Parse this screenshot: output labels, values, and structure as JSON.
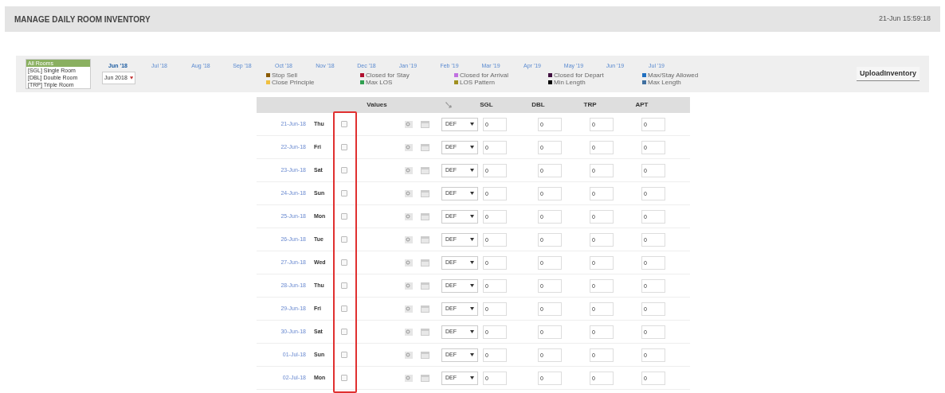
{
  "header": {
    "title": "MANAGE DAILY ROOM INVENTORY",
    "timestamp": "21-Jun 15:59:18"
  },
  "room_list": [
    {
      "label": "All Rooms",
      "selected": true
    },
    {
      "label": "[SGL] Single Room",
      "selected": false
    },
    {
      "label": "[DBL] Double Room",
      "selected": false
    },
    {
      "label": "[TRP] Triple Room",
      "selected": false
    }
  ],
  "month_select": {
    "value": "Jun 2018"
  },
  "months": [
    {
      "label": "Jun '18",
      "selected": true
    },
    {
      "label": "Jul '18",
      "selected": false
    },
    {
      "label": "Aug '18",
      "selected": false
    },
    {
      "label": "Sep '18",
      "selected": false
    },
    {
      "label": "Oct '18",
      "selected": false
    },
    {
      "label": "Nov '18",
      "selected": false
    },
    {
      "label": "Dec '18",
      "selected": false
    },
    {
      "label": "Jan '19",
      "selected": false
    },
    {
      "label": "Feb '19",
      "selected": false
    },
    {
      "label": "Mar '19",
      "selected": false
    },
    {
      "label": "Apr '19",
      "selected": false
    },
    {
      "label": "May '19",
      "selected": false
    },
    {
      "label": "Jun '19",
      "selected": false
    },
    {
      "label": "Jul '19",
      "selected": false
    }
  ],
  "legend": [
    [
      {
        "label": "Stop Sell",
        "color": "#8a5a00"
      },
      {
        "label": "Close Principle",
        "color": "#f0c040"
      }
    ],
    [
      {
        "label": "Closed for Stay",
        "color": "#b01030"
      },
      {
        "label": "Max LOS",
        "color": "#30a050"
      }
    ],
    [
      {
        "label": "Closed for Arrival",
        "color": "#c070e0"
      },
      {
        "label": "LOS Pattern",
        "color": "#a09020"
      }
    ],
    [
      {
        "label": "Closed for Depart",
        "color": "#401040"
      },
      {
        "label": "Min Length",
        "color": "#000000"
      }
    ],
    [
      {
        "label": "Max/Stay Allowed",
        "color": "#2070c0"
      },
      {
        "label": "Max Length",
        "color": "#4070a0"
      }
    ]
  ],
  "upload_button": "UploadInventory",
  "table": {
    "columns": [
      "Values",
      "SGL",
      "DBL",
      "TRP",
      "APT"
    ],
    "rows": [
      {
        "date": "21-Jun-18",
        "day": "Thu",
        "rate": "DEF",
        "values": [
          "0",
          "0",
          "0",
          "0"
        ],
        "checked": false
      },
      {
        "date": "22-Jun-18",
        "day": "Fri",
        "rate": "DEF",
        "values": [
          "0",
          "0",
          "0",
          "0"
        ],
        "checked": false
      },
      {
        "date": "23-Jun-18",
        "day": "Sat",
        "rate": "DEF",
        "values": [
          "0",
          "0",
          "0",
          "0"
        ],
        "checked": false
      },
      {
        "date": "24-Jun-18",
        "day": "Sun",
        "rate": "DEF",
        "values": [
          "0",
          "0",
          "0",
          "0"
        ],
        "checked": false
      },
      {
        "date": "25-Jun-18",
        "day": "Mon",
        "rate": "DEF",
        "values": [
          "0",
          "0",
          "0",
          "0"
        ],
        "checked": false
      },
      {
        "date": "26-Jun-18",
        "day": "Tue",
        "rate": "DEF",
        "values": [
          "0",
          "0",
          "0",
          "0"
        ],
        "checked": false
      },
      {
        "date": "27-Jun-18",
        "day": "Wed",
        "rate": "DEF",
        "values": [
          "0",
          "0",
          "0",
          "0"
        ],
        "checked": false
      },
      {
        "date": "28-Jun-18",
        "day": "Thu",
        "rate": "DEF",
        "values": [
          "0",
          "0",
          "0",
          "0"
        ],
        "checked": false
      },
      {
        "date": "29-Jun-18",
        "day": "Fri",
        "rate": "DEF",
        "values": [
          "0",
          "0",
          "0",
          "0"
        ],
        "checked": false
      },
      {
        "date": "30-Jun-18",
        "day": "Sat",
        "rate": "DEF",
        "values": [
          "0",
          "0",
          "0",
          "0"
        ],
        "checked": false
      },
      {
        "date": "01-Jul-18",
        "day": "Sun",
        "rate": "DEF",
        "values": [
          "0",
          "0",
          "0",
          "0"
        ],
        "checked": false
      },
      {
        "date": "02-Jul-18",
        "day": "Mon",
        "rate": "DEF",
        "values": [
          "0",
          "0",
          "0",
          "0"
        ],
        "checked": false
      }
    ]
  }
}
